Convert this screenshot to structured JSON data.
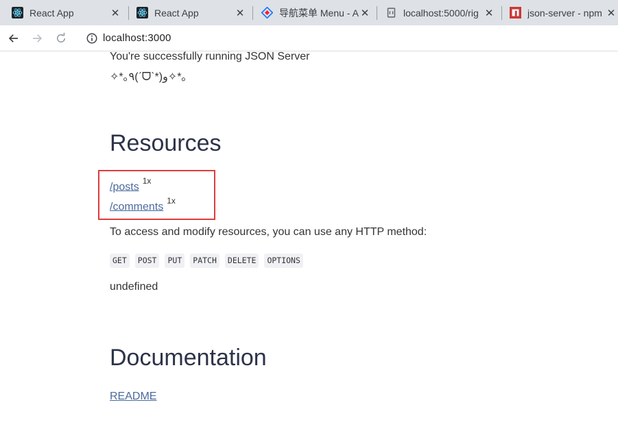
{
  "browser": {
    "tabs": [
      {
        "title": "React App",
        "icon": "react-icon"
      },
      {
        "title": "React App",
        "icon": "react-icon"
      },
      {
        "title": "导航菜单 Menu - A",
        "icon": "antd-icon"
      },
      {
        "title": "localhost:5000/rig",
        "icon": "page-icon"
      },
      {
        "title": "json-server - npm",
        "icon": "npm-icon"
      }
    ],
    "close_glyph": "✕",
    "address": "localhost:3000"
  },
  "page": {
    "running_text": "You're successfully running JSON Server",
    "kaomoji": "✧*｡٩(ˊᗜˋ*)و✧*｡",
    "resources_heading": "Resources",
    "resources": [
      {
        "path": "/posts",
        "count": "1x"
      },
      {
        "path": "/comments",
        "count": "1x"
      }
    ],
    "access_text": "To access and modify resources, you can use any HTTP method:",
    "methods": [
      "GET",
      "POST",
      "PUT",
      "PATCH",
      "DELETE",
      "OPTIONS"
    ],
    "undefined_text": "undefined",
    "documentation_heading": "Documentation",
    "readme_link": "README"
  },
  "colors": {
    "link": "#4a6a9f",
    "highlight": "#e03a3a",
    "heading": "#2d3348"
  }
}
